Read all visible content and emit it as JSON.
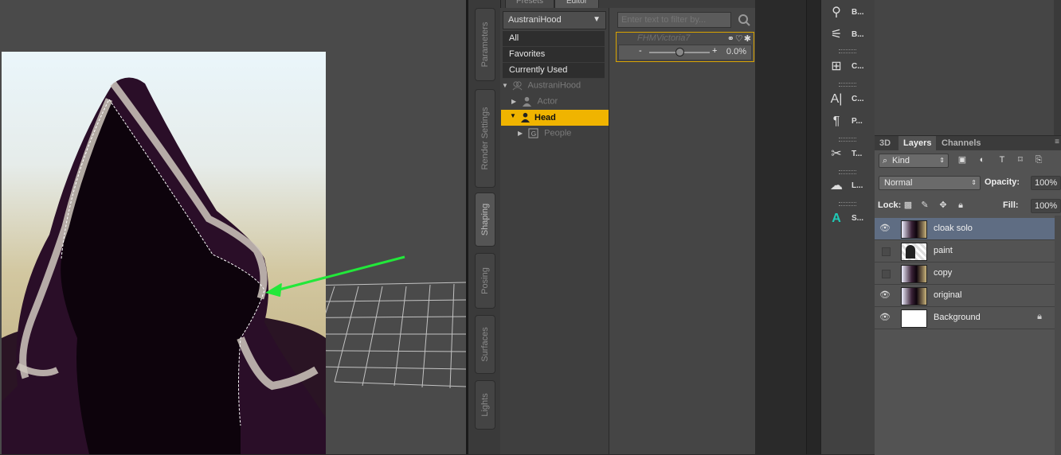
{
  "daz": {
    "top_tabs": [
      "Presets",
      "Editor"
    ],
    "vertical_tabs": [
      "Parameters",
      "Render Settings",
      "Shaping",
      "Posing",
      "Surfaces",
      "Lights"
    ],
    "node_select": "AustraniHood",
    "categories": [
      "All",
      "Favorites",
      "Currently Used"
    ],
    "tree": {
      "root": "AustraniHood",
      "actor": "Actor",
      "head": "Head",
      "people": "People"
    },
    "filter_placeholder": "Enter text to filter by...",
    "slider": {
      "label": "FHMVictoria7",
      "minus": "-",
      "plus": "+",
      "value": "0.0%",
      "level": 0.5
    }
  },
  "photoshop": {
    "tools": [
      {
        "icon": "puppet-icon",
        "label": "B..."
      },
      {
        "icon": "brush-presets-icon",
        "label": "B..."
      },
      {
        "icon": "clone-source-icon",
        "label": "C..."
      },
      {
        "icon": "character-icon",
        "label": "C..."
      },
      {
        "icon": "paragraph-icon",
        "label": "P..."
      },
      {
        "icon": "tool-presets-icon",
        "label": "T..."
      },
      {
        "icon": "libraries-icon",
        "label": "L..."
      },
      {
        "icon": "styles-icon",
        "label": "S..."
      }
    ],
    "tabs": [
      "3D",
      "Layers",
      "Channels"
    ],
    "active_tab": "Layers",
    "filter_kind": "Kind",
    "blend_mode": "Normal",
    "opacity_label": "Opacity:",
    "opacity": "100%",
    "lock_label": "Lock:",
    "fill_label": "Fill:",
    "fill": "100%",
    "layers": [
      {
        "name": "cloak solo",
        "visible": true,
        "selected": true,
        "locked": false
      },
      {
        "name": "paint",
        "visible": false,
        "selected": false,
        "locked": false
      },
      {
        "name": "copy",
        "visible": false,
        "selected": false,
        "locked": false
      },
      {
        "name": "original",
        "visible": true,
        "selected": false,
        "locked": false
      },
      {
        "name": "Background",
        "visible": true,
        "selected": false,
        "locked": true
      }
    ]
  },
  "colors": {
    "selection_yellow": "#f0b400",
    "arrow_green": "#22e83a",
    "hood_purple": "#2a0e28",
    "layer_selected": "#5f6d83"
  }
}
